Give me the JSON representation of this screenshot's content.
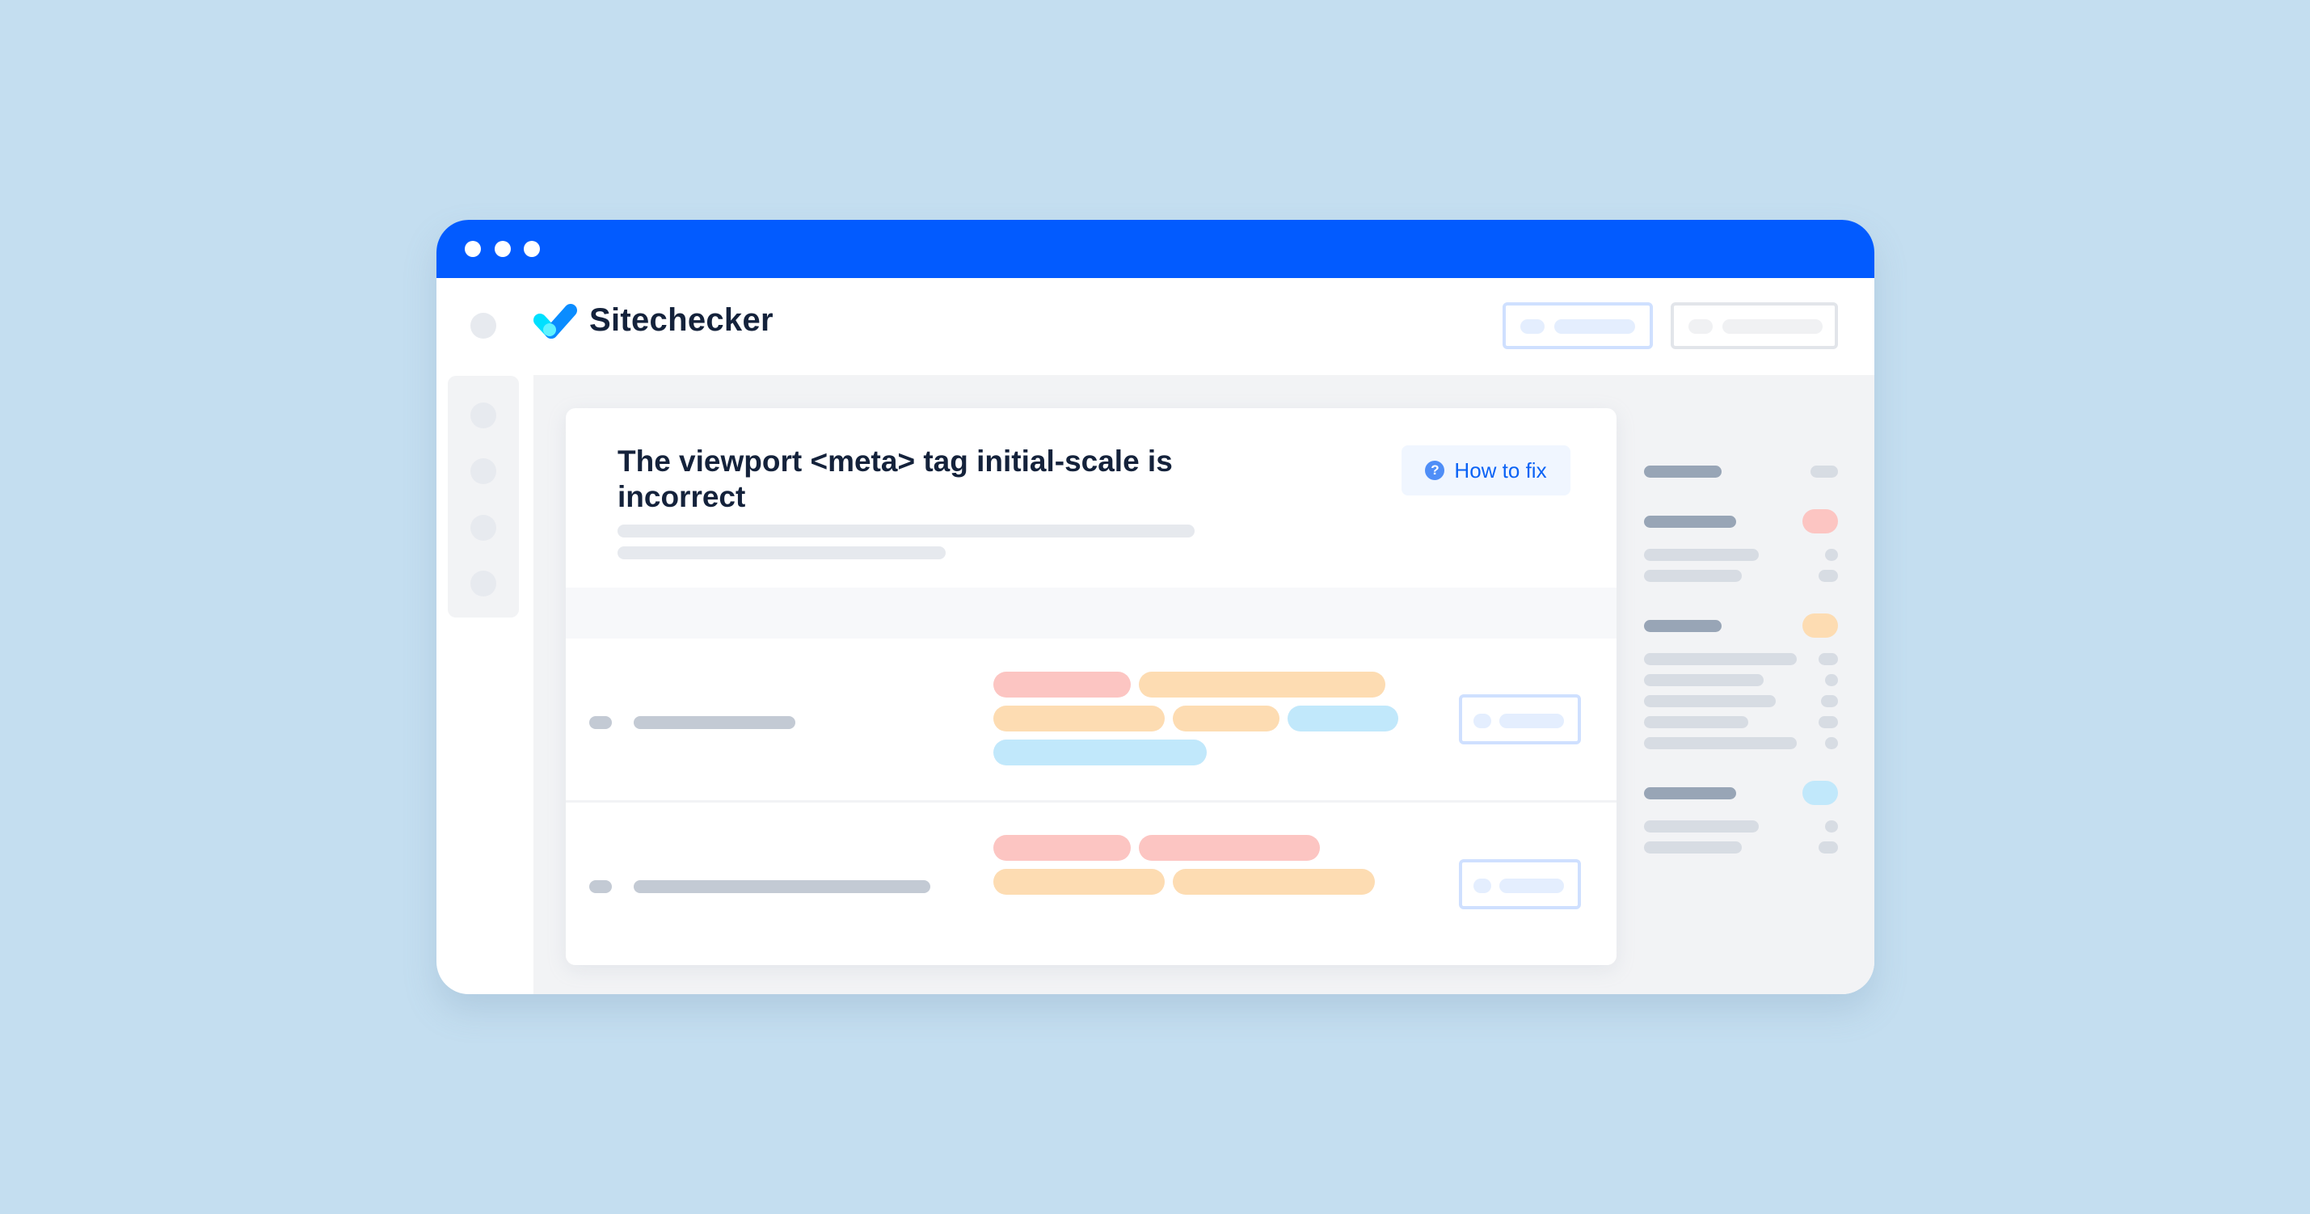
{
  "colors": {
    "page_background": "#c4def0",
    "titlebar": "#025bff",
    "brand_text": "#14223b",
    "link_blue": "#0a62f5",
    "tag_red": "#fcc5c2",
    "tag_orange": "#fddcb2",
    "tag_blue": "#c1e8fb",
    "skeleton_dark": "#98a5b6",
    "skeleton_light": "#d7dce3"
  },
  "window": {
    "titlebar_dots": [
      "close-dot",
      "minimize-dot",
      "maximize-dot"
    ]
  },
  "header": {
    "brand_name": "Sitechecker",
    "logo_icon": "checkmark-logo-icon",
    "buttons": [
      {
        "name": "header-primary-button",
        "state": "placeholder"
      },
      {
        "name": "header-secondary-button",
        "state": "placeholder"
      }
    ]
  },
  "sidebar": {
    "items": [
      "nav-item-1",
      "nav-item-2",
      "nav-item-3",
      "nav-item-4"
    ]
  },
  "issue": {
    "title": "The viewport <meta> tag initial-scale is incorrect",
    "how_to_fix_label": "How to fix",
    "how_to_fix_icon": "question-circle-icon"
  },
  "table": {
    "rows": [
      {
        "tags": [
          [
            "red",
            "orange"
          ],
          [
            "orange",
            "orange",
            "blue"
          ],
          [
            "blue"
          ]
        ]
      },
      {
        "tags": [
          [
            "red",
            "red"
          ],
          [
            "orange",
            "orange"
          ]
        ]
      }
    ]
  },
  "summary_panel": {
    "groups": [
      {
        "badge": "neutral",
        "items": 0
      },
      {
        "badge": "red",
        "items": 2
      },
      {
        "badge": "orange",
        "items": 5
      },
      {
        "badge": "blue",
        "items": 2
      }
    ]
  }
}
